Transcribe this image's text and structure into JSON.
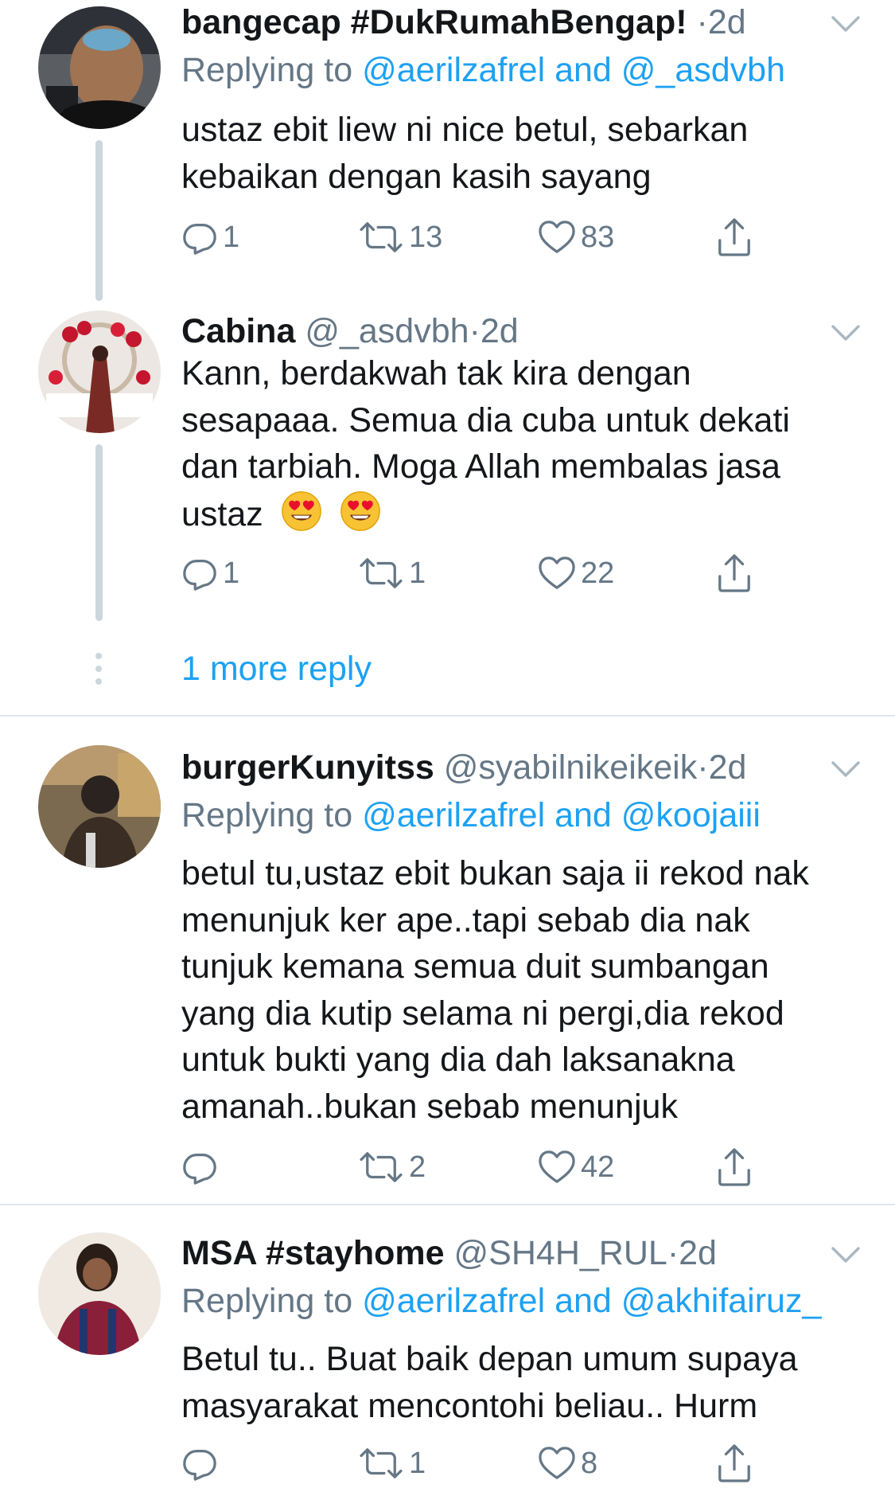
{
  "colors": {
    "text": "#14171a",
    "secondary": "#657786",
    "link": "#1da1f2",
    "divider": "#e1e8ed",
    "thread_line": "#ccd6dd"
  },
  "tweets": [
    {
      "name": "bangecap #DukRumahBengap!",
      "handle": "",
      "separator": "·",
      "time": "2d",
      "replying_prefix": "Replying to",
      "mentions": "@aerilzafrel and @_asdvbh",
      "text": "ustaz ebit liew ni nice betul, sebarkan\nkebaikan dengan kasih sayang",
      "actions": {
        "reply": "1",
        "retweet": "13",
        "like": "83"
      }
    },
    {
      "name": "Cabina",
      "handle": "@_asdvbh",
      "separator": "·",
      "time": "2d",
      "text": "Kann, berdakwah tak kira dengan\nsesapaaa. Semua dia cuba untuk dekati\ndan tarbiah. Moga Allah membalas jasa\nustaz",
      "emoji": "smiling-face-with-heart-eyes",
      "actions": {
        "reply": "1",
        "retweet": "1",
        "like": "22"
      }
    },
    {
      "name": "burgerKunyitss",
      "handle": "@syabilnikeikeik",
      "separator": "·",
      "time": "2d",
      "replying_prefix": "Replying to",
      "mentions": "@aerilzafrel and @koojaiii",
      "text": "betul tu,ustaz ebit bukan saja ii rekod nak\nmenunjuk ker ape..tapi sebab dia nak\ntunjuk kemana semua duit sumbangan\nyang dia kutip selama ni pergi,dia rekod\nuntuk bukti yang dia dah laksanakna\namanah..bukan sebab menunjuk",
      "actions": {
        "reply": "",
        "retweet": "2",
        "like": "42"
      }
    },
    {
      "name": "MSA #stayhome",
      "handle": "@SH4H_RUL",
      "separator": "·",
      "time": "2d",
      "replying_prefix": "Replying to",
      "mentions": "@aerilzafrel and @akhifairuz_",
      "text": "Betul tu.. Buat baik depan umum supaya\nmasyarakat mencontohi beliau.. Hurm",
      "actions": {
        "reply": "",
        "retweet": "1",
        "like": "8"
      }
    }
  ],
  "more_replies_label": "1 more reply",
  "icons": {
    "reply": "reply-icon",
    "retweet": "retweet-icon",
    "like": "heart-icon",
    "share": "share-icon",
    "menu": "chevron-down-icon"
  }
}
